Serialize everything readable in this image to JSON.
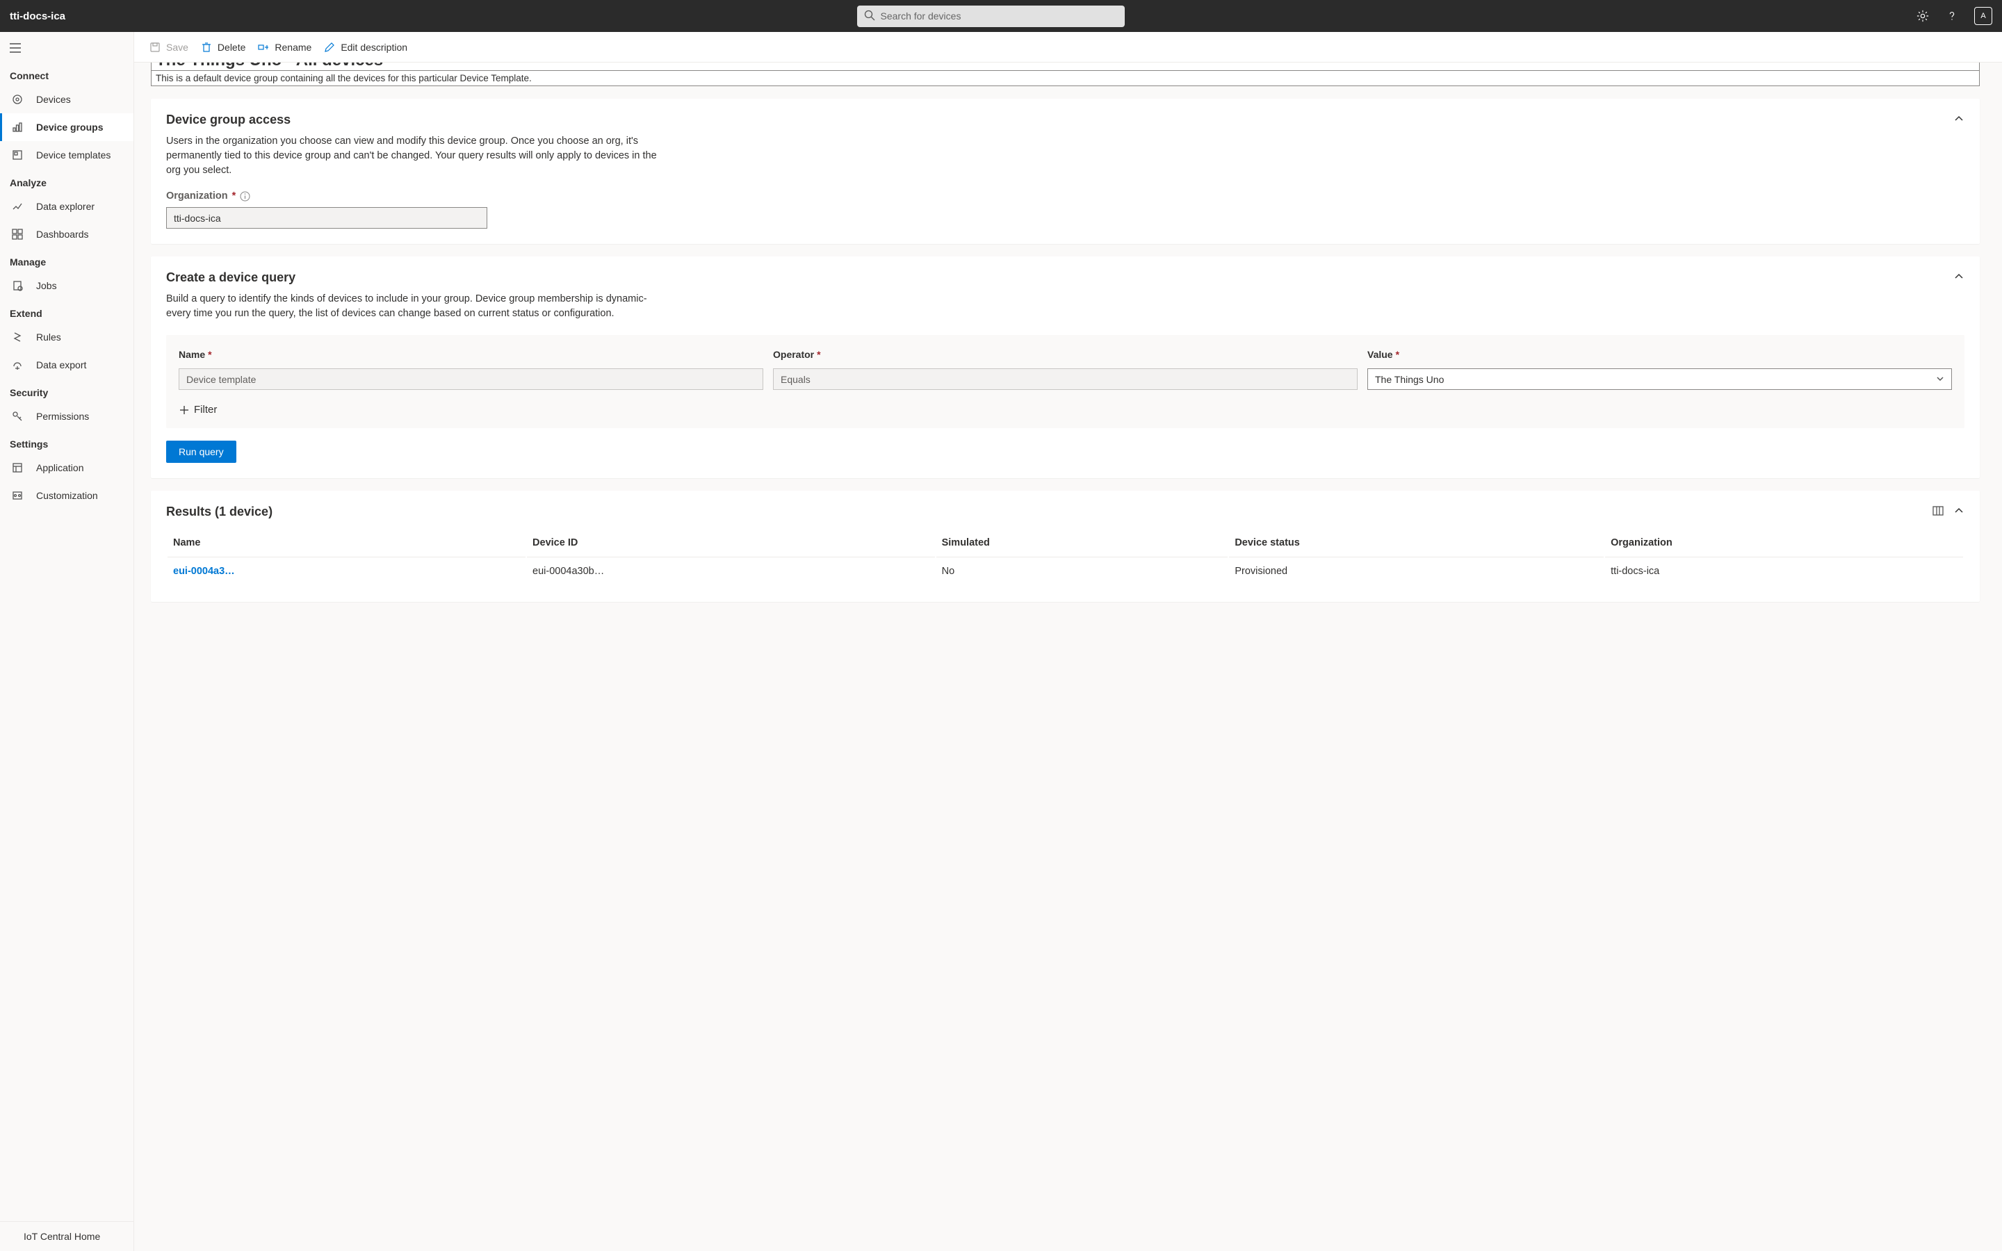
{
  "app_title": "tti-docs-ica",
  "search_placeholder": "Search for devices",
  "avatar_initial": "A",
  "toolbar": {
    "save": "Save",
    "delete": "Delete",
    "rename": "Rename",
    "edit_desc": "Edit description"
  },
  "sidebar": {
    "sections": [
      {
        "title": "Connect",
        "items": [
          {
            "icon": "devices",
            "label": "Devices"
          },
          {
            "icon": "device-groups",
            "label": "Device groups",
            "active": true
          },
          {
            "icon": "templates",
            "label": "Device templates"
          }
        ]
      },
      {
        "title": "Analyze",
        "items": [
          {
            "icon": "data-explorer",
            "label": "Data explorer"
          },
          {
            "icon": "dashboards",
            "label": "Dashboards"
          }
        ]
      },
      {
        "title": "Manage",
        "items": [
          {
            "icon": "jobs",
            "label": "Jobs"
          }
        ]
      },
      {
        "title": "Extend",
        "items": [
          {
            "icon": "rules",
            "label": "Rules"
          },
          {
            "icon": "data-export",
            "label": "Data export"
          }
        ]
      },
      {
        "title": "Security",
        "items": [
          {
            "icon": "permissions",
            "label": "Permissions"
          }
        ]
      },
      {
        "title": "Settings",
        "items": [
          {
            "icon": "application",
            "label": "Application"
          },
          {
            "icon": "customization",
            "label": "Customization"
          }
        ]
      }
    ],
    "footer": {
      "label": "IoT Central Home"
    }
  },
  "page": {
    "title_partial": "The Things Uno - All devices",
    "description": "This is a default device group containing all the devices for this particular Device Template."
  },
  "access": {
    "title": "Device group access",
    "description": "Users in the organization you choose can view and modify this device group. Once you choose an org, it's permanently tied to this device group and can't be changed. Your query results will only apply to devices in the org you select.",
    "org_label": "Organization",
    "org_value": "tti-docs-ica"
  },
  "query": {
    "title": "Create a device query",
    "description": "Build a query to identify the kinds of devices to include in your group. Device group membership is dynamic-every time you run the query, the list of devices can change based on current status or configuration.",
    "cols": {
      "name": {
        "label": "Name",
        "placeholder": "Device template"
      },
      "operator": {
        "label": "Operator",
        "placeholder": "Equals"
      },
      "value": {
        "label": "Value",
        "value": "The Things Uno"
      }
    },
    "add_filter": "Filter",
    "run": "Run query"
  },
  "results": {
    "title": "Results (1 device)",
    "columns": [
      "Name",
      "Device ID",
      "Simulated",
      "Device status",
      "Organization"
    ],
    "rows": [
      {
        "name": "eui-0004a3…",
        "device_id": "eui-0004a30b…",
        "simulated": "No",
        "status": "Provisioned",
        "org": "tti-docs-ica"
      }
    ]
  }
}
